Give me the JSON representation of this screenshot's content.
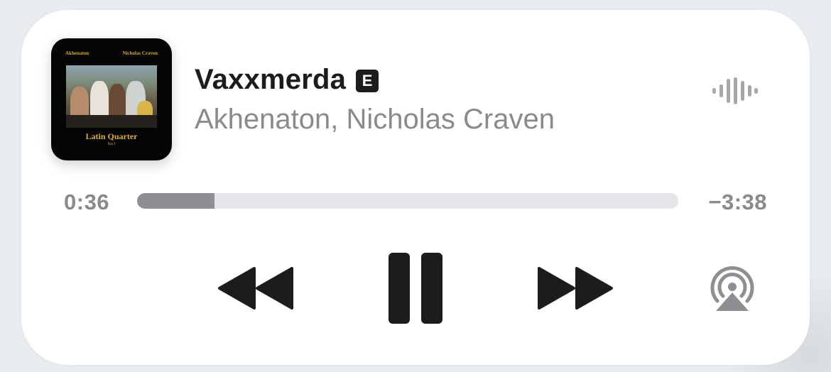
{
  "now_playing": {
    "title": "Vaxxmerda",
    "explicit_badge": "E",
    "artist": "Akhenaton, Nicholas Craven",
    "artwork": {
      "top_left": "Akhenaton",
      "top_right": "Nicholas Craven",
      "title": "Latin Quarter",
      "subtitle": "Part I"
    }
  },
  "progress": {
    "elapsed": "0:36",
    "remaining": "−3:38",
    "fraction": 0.143
  },
  "icons": {
    "waveform": "waveform-icon",
    "rewind": "backward-icon",
    "pause": "pause-icon",
    "forward": "forward-icon",
    "airplay": "airplay-icon"
  },
  "colors": {
    "primary_text": "#1c1c1e",
    "secondary_text": "#8a8a8e",
    "track": "#e5e5ea",
    "fill": "#8e8e93"
  }
}
